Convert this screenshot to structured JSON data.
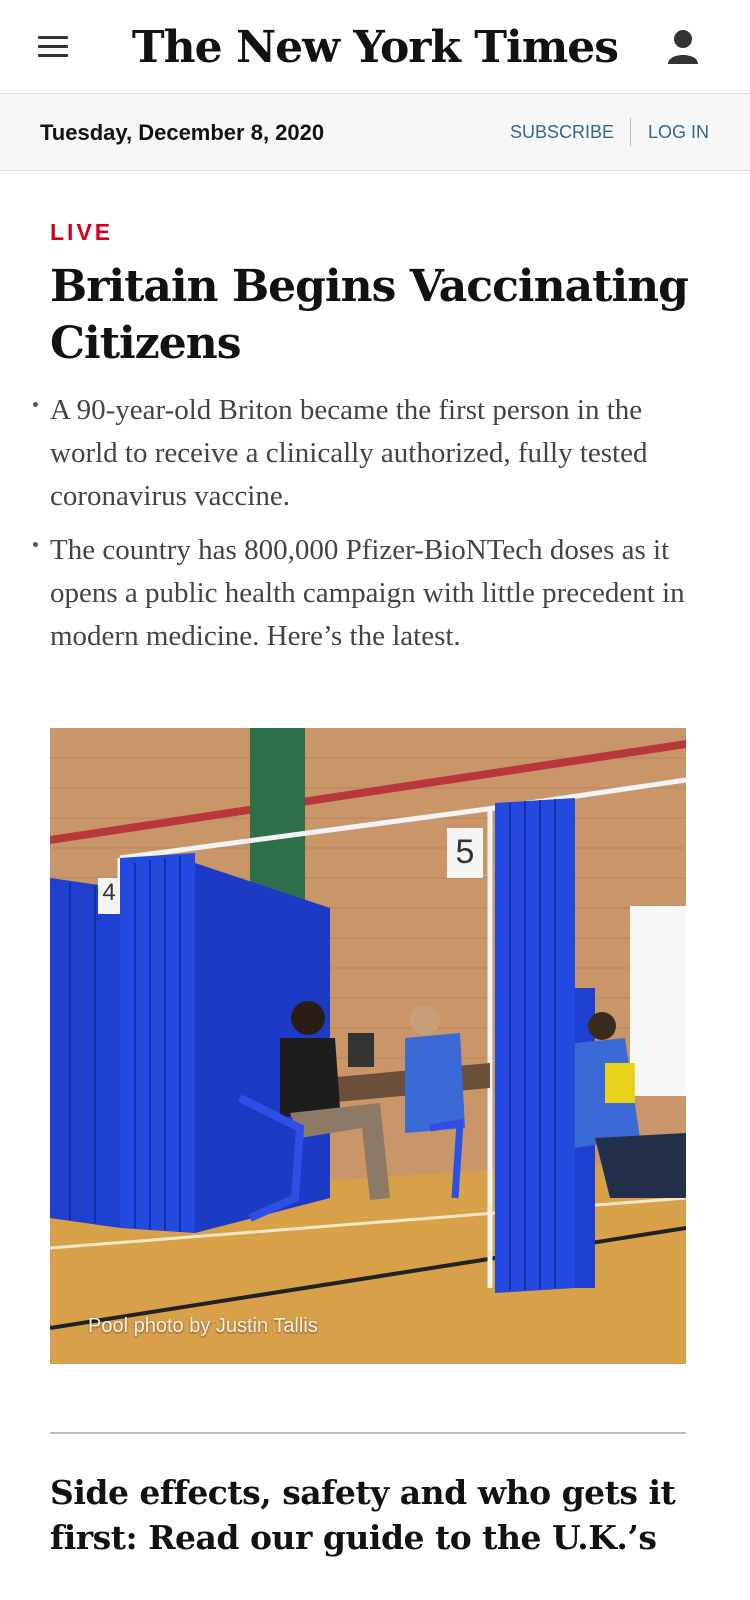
{
  "masthead": {
    "logo_text": "The New York Times",
    "menu_icon": "hamburger-menu-icon",
    "account_icon": "user-account-icon"
  },
  "datebar": {
    "date": "Tuesday, December 8, 2020",
    "subscribe_label": "SUBSCRIBE",
    "login_label": "LOG IN"
  },
  "article": {
    "live_label": "LIVE",
    "headline": "Britain Begins Vaccinating Citizens",
    "summary": [
      "A 90-year-old Briton became the first person in the world to receive a clinically authorized, fully tested coronavirus vaccine.",
      "The country has 800,000 Pfizer-BioNTech doses as it opens a public health campaign with little precedent in modern medicine. Here’s the latest."
    ],
    "photo_credit": "Pool photo by Justin Tallis",
    "booth_numbers": [
      "4",
      "5"
    ]
  },
  "next_story": {
    "headline": "Side effects, safety and who gets it first: Read our guide to the U.K.’s"
  },
  "colors": {
    "live_red": "#d0021b",
    "link_blue": "#326891",
    "headline_black": "#121212",
    "curtain_blue": "#1e3fd0"
  }
}
